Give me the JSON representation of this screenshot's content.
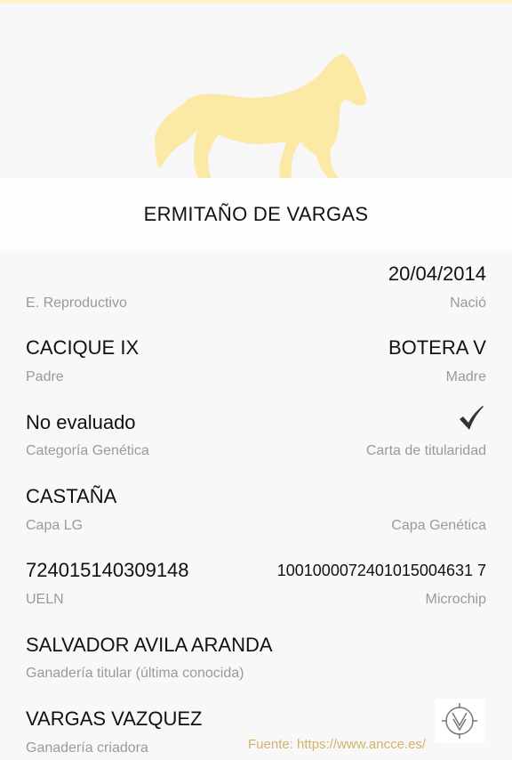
{
  "horse": {
    "name": "ERMITAÑO DE VARGAS"
  },
  "fields": {
    "birth": {
      "value": "20/04/2014",
      "label": "Nació"
    },
    "repro": {
      "label": "E. Reproductivo"
    },
    "father": {
      "value": "CACIQUE IX",
      "label": "Padre"
    },
    "mother": {
      "value": "BOTERA V",
      "label": "Madre"
    },
    "genetic_category": {
      "value": "No evaluado",
      "label": "Categoría Genética"
    },
    "ownership_card": {
      "label": "Carta de titularidad",
      "icon": "checkmark-icon"
    },
    "coat_lg": {
      "value": "CASTAÑA",
      "label": "Capa LG"
    },
    "coat_genetic": {
      "label": "Capa Genética"
    },
    "ueln": {
      "value": "724015140309148",
      "label": "UELN"
    },
    "microchip": {
      "value": "1001000072401015004631 7",
      "label": "Microchip"
    },
    "owner": {
      "value": "SALVADOR AVILA ARANDA",
      "label": "Ganadería titular (última conocida)"
    },
    "breeder": {
      "value": "VARGAS VAZQUEZ",
      "label": "Ganadería criadora"
    }
  },
  "footer": {
    "source": "Fuente: https://www.ancce.es/"
  },
  "colors": {
    "horse": "#fde9a6",
    "label": "#9a9a9a",
    "source": "#d4b26a"
  }
}
